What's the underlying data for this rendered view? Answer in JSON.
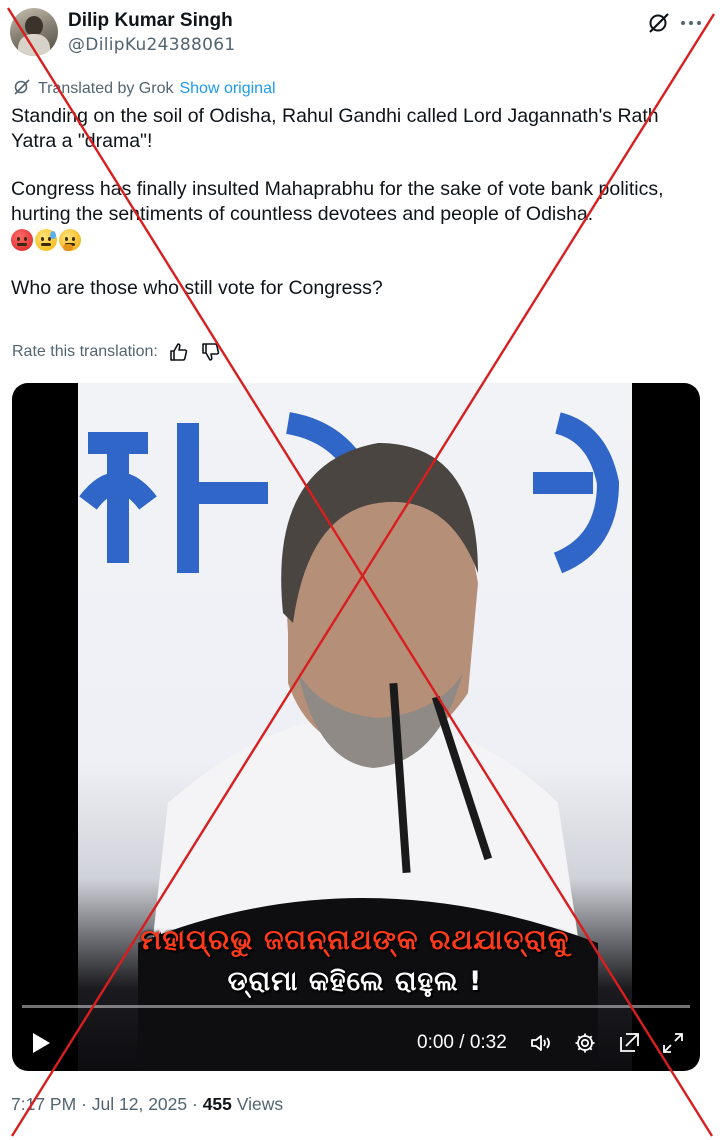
{
  "author": {
    "name": "Dilip Kumar Singh",
    "handle": "@DilipKu24388061"
  },
  "translation": {
    "translated_by": "Translated by Grok",
    "show_original": "Show original",
    "rate_label": "Rate this translation:"
  },
  "tweet": {
    "line1": "Standing on the soil of Odisha, Rahul Gandhi called Lord Jagannath's Rath Yatra a \"drama\"!",
    "line2": "Congress has finally insulted Mahaprabhu for the sake of vote bank politics, hurting the sentiments of countless devotees and people of Odisha.",
    "line3": "Who are those who still vote for Congress?",
    "emojis": [
      "angry-face",
      "anxious-face-with-sweat",
      "thinking-face"
    ]
  },
  "video": {
    "caption_line1": "ମହାପ୍ରଭୁ ଜଗନ୍ନାଥଙ୍କ ରଥଯାତ୍ରାକୁ",
    "caption_line2": "ଡ୍ରାମା କହିଲେ ରାହୁଲ !",
    "time": "0:00 / 0:32",
    "progress": 0
  },
  "meta": {
    "time": "7:17 PM",
    "date": "Jul 12, 2025",
    "sep": "·",
    "views_count": "455",
    "views_label": "Views"
  },
  "colors": {
    "link": "#1d9bf0",
    "secondary_text": "#536471",
    "cross_overlay": "#d81e1e"
  }
}
